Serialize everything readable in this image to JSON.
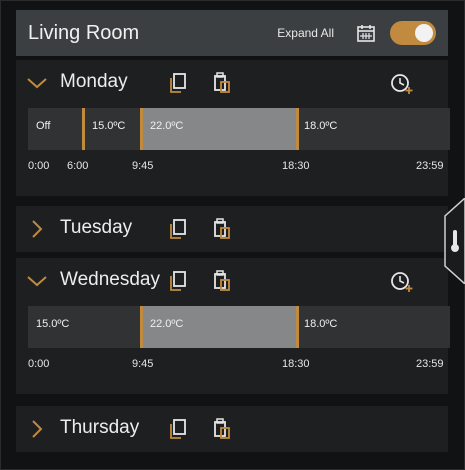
{
  "header": {
    "title": "Living Room",
    "expand_all": "Expand All"
  },
  "colors": {
    "accent": "#c28a3e",
    "schedule_light": "#858789",
    "schedule_dark": "#303234"
  },
  "days": {
    "monday": {
      "name": "Monday",
      "expanded": true,
      "segments": [
        "Off",
        "15.0ºC",
        "22.0ºC",
        "18.0ºC"
      ],
      "ticks": [
        "0:00",
        "6:00",
        "9:45",
        "18:30",
        "23:59"
      ]
    },
    "tuesday": {
      "name": "Tuesday",
      "expanded": false
    },
    "wednesday": {
      "name": "Wednesday",
      "expanded": true,
      "segments": [
        "15.0ºC",
        "22.0ºC",
        "18.0ºC"
      ],
      "ticks": [
        "0:00",
        "9:45",
        "18:30",
        "23:59"
      ]
    },
    "thursday": {
      "name": "Thursday",
      "expanded": false
    }
  },
  "icons": {
    "calendar": "calendar-icon",
    "copy": "copy-icon",
    "paste": "paste-icon",
    "add_time": "clock-plus-icon",
    "thermometer": "thermometer-icon"
  }
}
